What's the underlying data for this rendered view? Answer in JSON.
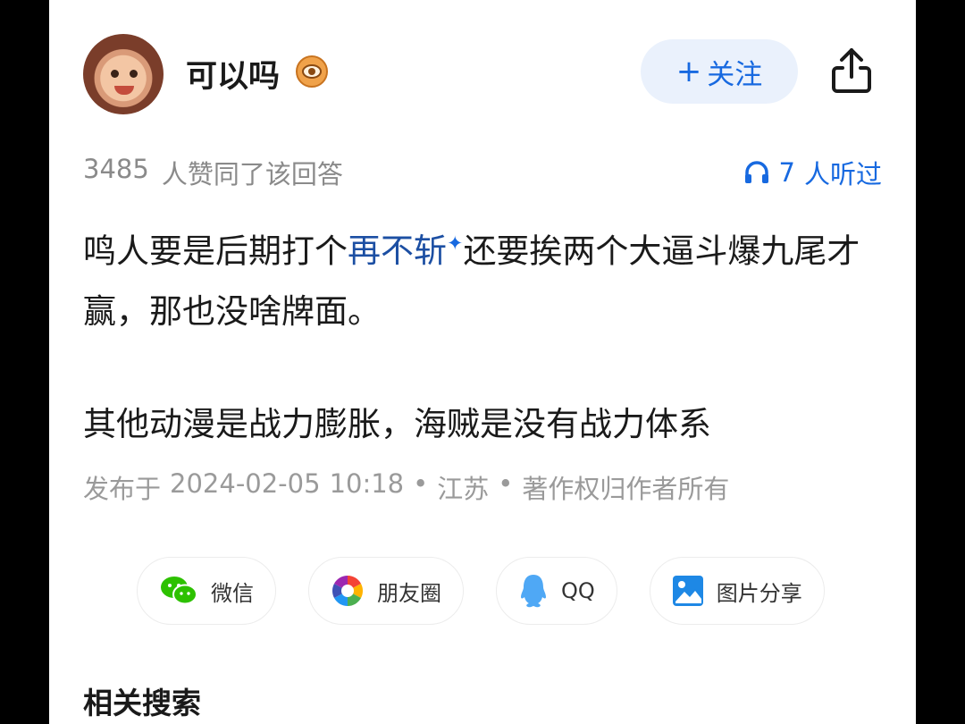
{
  "author": {
    "name": "可以吗"
  },
  "header": {
    "follow_label": "关注",
    "follow_prefix": "+"
  },
  "stats": {
    "likes_count": "3485",
    "likes_text": "人赞同了该回答",
    "listen_count": "7",
    "listen_text": "人听过"
  },
  "answer": {
    "p1_before": "鸣人要是后期打个",
    "p1_link": "再不斩",
    "p1_link_mark": "✦",
    "p1_after": "还要挨两个大逼斗爆九尾才赢，那也没啥牌面。",
    "p2": "其他动漫是战力膨胀，海贼是没有战力体系"
  },
  "meta": {
    "published_label": "发布于",
    "date": "2024-02-05",
    "time": "10:18",
    "separator": "•",
    "location": "江苏",
    "copyright": "著作权归作者所有"
  },
  "share": [
    {
      "label": "微信",
      "icon": "wechat-icon"
    },
    {
      "label": "朋友圈",
      "icon": "moments-icon"
    },
    {
      "label": "QQ",
      "icon": "qq-icon"
    },
    {
      "label": "图片分享",
      "icon": "image-share-icon"
    }
  ],
  "related": {
    "title": "相关搜索"
  },
  "colors": {
    "accent": "#1769e0",
    "follow_bg": "#eaf1fc",
    "muted": "#8a8a8a",
    "wechat": "#2dc100",
    "qq": "#4fa8f5",
    "image_share": "#1e88e5"
  }
}
